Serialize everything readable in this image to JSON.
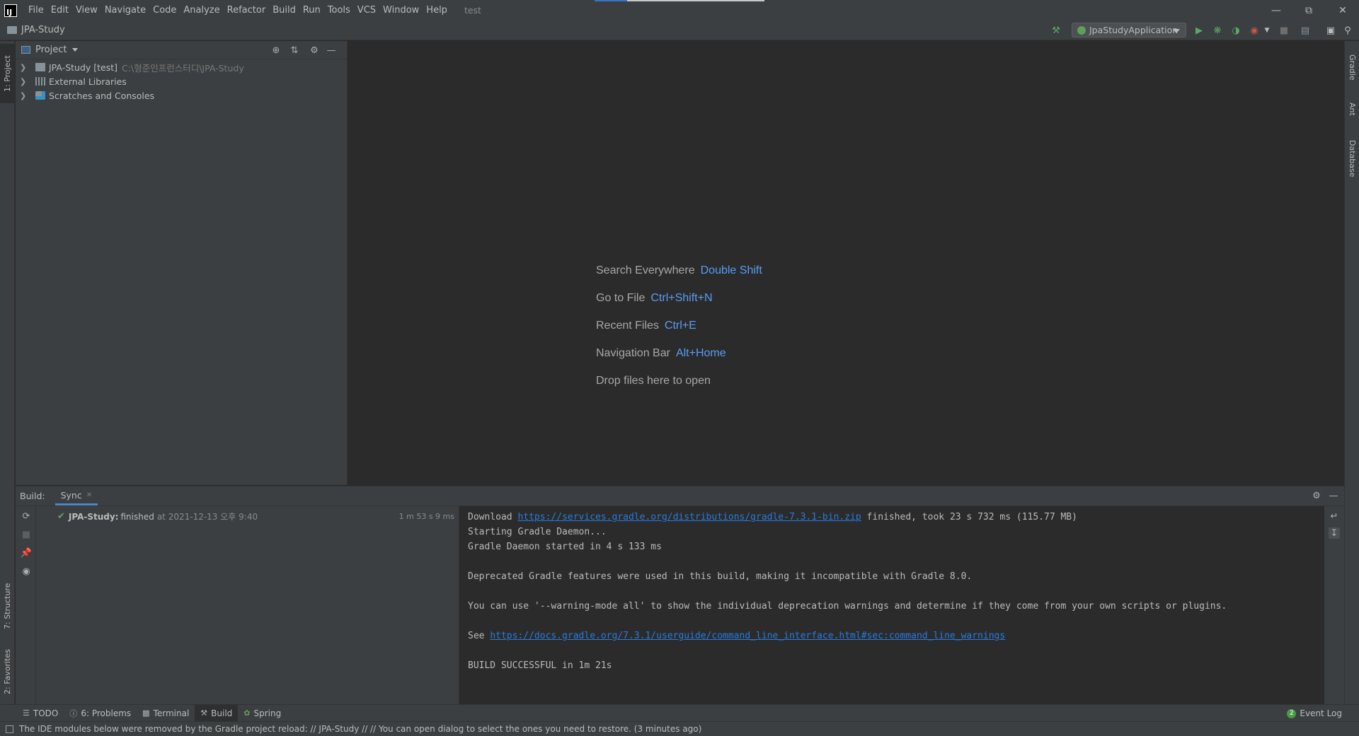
{
  "menubar": {
    "items": [
      "File",
      "Edit",
      "View",
      "Navigate",
      "Code",
      "Analyze",
      "Refactor",
      "Build",
      "Run",
      "Tools",
      "VCS",
      "Window",
      "Help"
    ],
    "window_title": "test"
  },
  "navbar": {
    "project_name": "JPA-Study",
    "run_config": "JpaStudyApplication"
  },
  "left_stripe": {
    "project_tab": "1: Project",
    "structure_tab": "7: Structure",
    "favorites_tab": "2: Favorites"
  },
  "right_stripe": {
    "gradle_tab": "Gradle",
    "ant_tab": "Ant",
    "database_tab": "Database"
  },
  "project_panel": {
    "title": "Project",
    "tree": [
      {
        "label": "JPA-Study [test]",
        "hint": "C:\\형준인프런스터디\\JPA-Study"
      },
      {
        "label": "External Libraries",
        "hint": ""
      },
      {
        "label": "Scratches and Consoles",
        "hint": ""
      }
    ]
  },
  "editor": {
    "welcome": [
      {
        "label": "Search Everywhere",
        "key": "Double Shift"
      },
      {
        "label": "Go to File",
        "key": "Ctrl+Shift+N"
      },
      {
        "label": "Recent Files",
        "key": "Ctrl+E"
      },
      {
        "label": "Navigation Bar",
        "key": "Alt+Home"
      },
      {
        "label": "Drop files here to open",
        "key": ""
      }
    ]
  },
  "build": {
    "label": "Build:",
    "tab": "Sync",
    "tree_project": "JPA-Study:",
    "tree_status": "finished",
    "tree_time": "at 2021-12-13 오후 9:40",
    "duration": "1 m 53 s 9 ms",
    "console": {
      "line1_prefix": "Download ",
      "line1_link": "https://services.gradle.org/distributions/gradle-7.3.1-bin.zip",
      "line1_suffix": " finished, took 23 s 732 ms (115.77 MB)",
      "line2": "Starting Gradle Daemon...",
      "line3": "Gradle Daemon started in 4 s 133 ms",
      "line5": "Deprecated Gradle features were used in this build, making it incompatible with Gradle 8.0.",
      "line7": "You can use '--warning-mode all' to show the individual deprecation warnings and determine if they come from your own scripts or plugins.",
      "line9_prefix": "See ",
      "line9_link": "https://docs.gradle.org/7.3.1/userguide/command_line_interface.html#sec:command_line_warnings",
      "line11": "BUILD SUCCESSFUL in 1m 21s"
    }
  },
  "bottom_tabs": {
    "todo": "TODO",
    "problems": "6: Problems",
    "terminal": "Terminal",
    "build": "Build",
    "spring": "Spring",
    "event_log": "Event Log",
    "event_log_count": "2"
  },
  "statusbar": {
    "message": "The IDE modules below were removed by the Gradle project reload: // JPA-Study // // You can open dialog to select the ones you need to restore. (3 minutes ago)"
  },
  "colors": {
    "accent_blue": "#589df6",
    "link": "#287bde",
    "success_green": "#59a869"
  }
}
